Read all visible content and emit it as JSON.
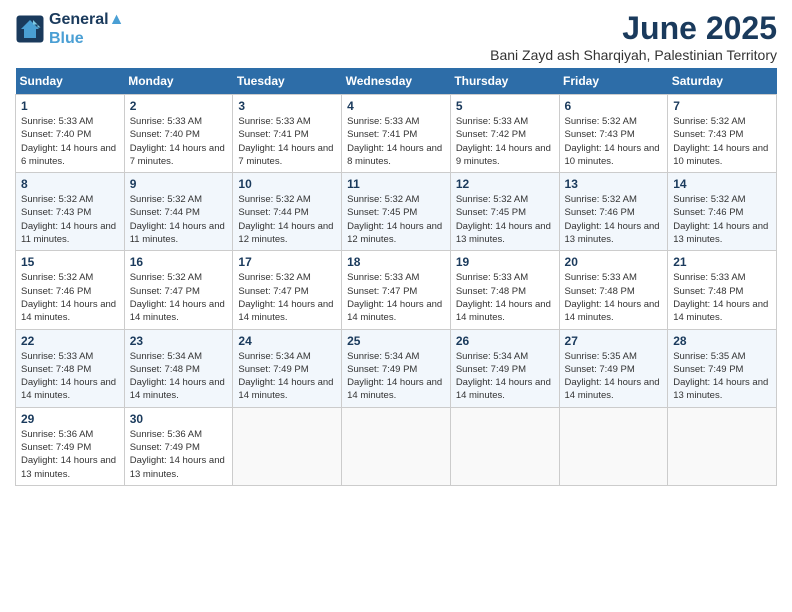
{
  "logo": {
    "line1": "General",
    "line2": "Blue"
  },
  "title": "June 2025",
  "location": "Bani Zayd ash Sharqiyah, Palestinian Territory",
  "days_header": [
    "Sunday",
    "Monday",
    "Tuesday",
    "Wednesday",
    "Thursday",
    "Friday",
    "Saturday"
  ],
  "weeks": [
    [
      {
        "day": 1,
        "sunrise": "5:33 AM",
        "sunset": "7:40 PM",
        "daylight": "14 hours and 6 minutes."
      },
      {
        "day": 2,
        "sunrise": "5:33 AM",
        "sunset": "7:40 PM",
        "daylight": "14 hours and 7 minutes."
      },
      {
        "day": 3,
        "sunrise": "5:33 AM",
        "sunset": "7:41 PM",
        "daylight": "14 hours and 7 minutes."
      },
      {
        "day": 4,
        "sunrise": "5:33 AM",
        "sunset": "7:41 PM",
        "daylight": "14 hours and 8 minutes."
      },
      {
        "day": 5,
        "sunrise": "5:33 AM",
        "sunset": "7:42 PM",
        "daylight": "14 hours and 9 minutes."
      },
      {
        "day": 6,
        "sunrise": "5:32 AM",
        "sunset": "7:43 PM",
        "daylight": "14 hours and 10 minutes."
      },
      {
        "day": 7,
        "sunrise": "5:32 AM",
        "sunset": "7:43 PM",
        "daylight": "14 hours and 10 minutes."
      }
    ],
    [
      {
        "day": 8,
        "sunrise": "5:32 AM",
        "sunset": "7:43 PM",
        "daylight": "14 hours and 11 minutes."
      },
      {
        "day": 9,
        "sunrise": "5:32 AM",
        "sunset": "7:44 PM",
        "daylight": "14 hours and 11 minutes."
      },
      {
        "day": 10,
        "sunrise": "5:32 AM",
        "sunset": "7:44 PM",
        "daylight": "14 hours and 12 minutes."
      },
      {
        "day": 11,
        "sunrise": "5:32 AM",
        "sunset": "7:45 PM",
        "daylight": "14 hours and 12 minutes."
      },
      {
        "day": 12,
        "sunrise": "5:32 AM",
        "sunset": "7:45 PM",
        "daylight": "14 hours and 13 minutes."
      },
      {
        "day": 13,
        "sunrise": "5:32 AM",
        "sunset": "7:46 PM",
        "daylight": "14 hours and 13 minutes."
      },
      {
        "day": 14,
        "sunrise": "5:32 AM",
        "sunset": "7:46 PM",
        "daylight": "14 hours and 13 minutes."
      }
    ],
    [
      {
        "day": 15,
        "sunrise": "5:32 AM",
        "sunset": "7:46 PM",
        "daylight": "14 hours and 14 minutes."
      },
      {
        "day": 16,
        "sunrise": "5:32 AM",
        "sunset": "7:47 PM",
        "daylight": "14 hours and 14 minutes."
      },
      {
        "day": 17,
        "sunrise": "5:32 AM",
        "sunset": "7:47 PM",
        "daylight": "14 hours and 14 minutes."
      },
      {
        "day": 18,
        "sunrise": "5:33 AM",
        "sunset": "7:47 PM",
        "daylight": "14 hours and 14 minutes."
      },
      {
        "day": 19,
        "sunrise": "5:33 AM",
        "sunset": "7:48 PM",
        "daylight": "14 hours and 14 minutes."
      },
      {
        "day": 20,
        "sunrise": "5:33 AM",
        "sunset": "7:48 PM",
        "daylight": "14 hours and 14 minutes."
      },
      {
        "day": 21,
        "sunrise": "5:33 AM",
        "sunset": "7:48 PM",
        "daylight": "14 hours and 14 minutes."
      }
    ],
    [
      {
        "day": 22,
        "sunrise": "5:33 AM",
        "sunset": "7:48 PM",
        "daylight": "14 hours and 14 minutes."
      },
      {
        "day": 23,
        "sunrise": "5:34 AM",
        "sunset": "7:48 PM",
        "daylight": "14 hours and 14 minutes."
      },
      {
        "day": 24,
        "sunrise": "5:34 AM",
        "sunset": "7:49 PM",
        "daylight": "14 hours and 14 minutes."
      },
      {
        "day": 25,
        "sunrise": "5:34 AM",
        "sunset": "7:49 PM",
        "daylight": "14 hours and 14 minutes."
      },
      {
        "day": 26,
        "sunrise": "5:34 AM",
        "sunset": "7:49 PM",
        "daylight": "14 hours and 14 minutes."
      },
      {
        "day": 27,
        "sunrise": "5:35 AM",
        "sunset": "7:49 PM",
        "daylight": "14 hours and 14 minutes."
      },
      {
        "day": 28,
        "sunrise": "5:35 AM",
        "sunset": "7:49 PM",
        "daylight": "14 hours and 13 minutes."
      }
    ],
    [
      {
        "day": 29,
        "sunrise": "5:36 AM",
        "sunset": "7:49 PM",
        "daylight": "14 hours and 13 minutes."
      },
      {
        "day": 30,
        "sunrise": "5:36 AM",
        "sunset": "7:49 PM",
        "daylight": "14 hours and 13 minutes."
      },
      null,
      null,
      null,
      null,
      null
    ]
  ],
  "labels": {
    "sunrise": "Sunrise:",
    "sunset": "Sunset:",
    "daylight": "Daylight:"
  }
}
